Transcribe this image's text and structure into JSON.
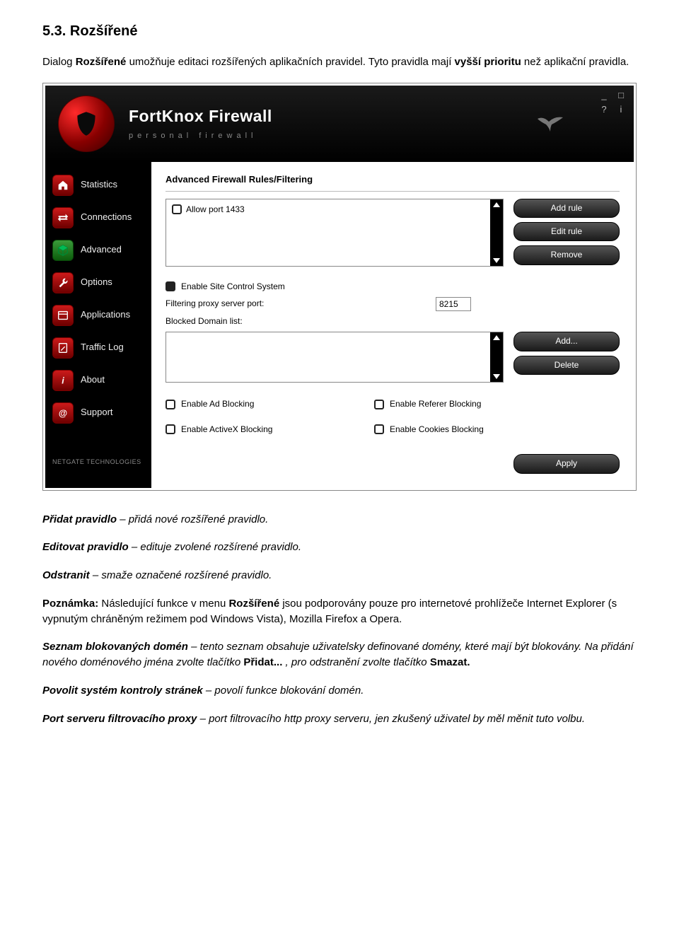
{
  "doc": {
    "heading": "5.3. Rozšířené",
    "intro_1": "Dialog ",
    "intro_strong": "Rozšířené",
    "intro_2": " umožňuje editaci rozšířených aplikačních pravidel. Tyto pravidla mají ",
    "intro_bold2": "vyšší prioritu",
    "intro_3": " než aplikační pravidla.",
    "p_add_label": "Přidat pravidlo",
    "p_add_text": " – přidá nové rozšířené pravidlo.",
    "p_edit_label": "Editovat pravidlo",
    "p_edit_text": " – edituje zvolené rozšírené pravidlo.",
    "p_del_label": "Odstranit",
    "p_del_text": " – smaže označené rozšírené pravidlo.",
    "note_label": "Poznámka:",
    "note_text_1": " Následující funkce v menu ",
    "note_strong": "Rozšířené",
    "note_text_2": " jsou podporovány pouze pro internetové prohlížeče Internet Explorer (s vypnutým chráněným režimem pod Windows Vista), Mozilla Firefox a Opera.",
    "p_blocked_label": "Seznam blokovaných domén",
    "p_blocked_text_1": " – tento seznam obsahuje uživatelsky definované domény, které mají být blokovány. Na přidání nového doménového jména zvolte tlačítko ",
    "p_blocked_btn1": "Přidat...",
    "p_blocked_text_2": ", pro odstranění zvolte tlačítko ",
    "p_blocked_btn2": "Smazat.",
    "p_enable_label": "Povolit systém kontroly stránek",
    "p_enable_text": " – povolí funkce blokování domén.",
    "p_port_label": "Port serveru filtrovacího proxy",
    "p_port_text": " – port filtrovacího http proxy serveru, jen zkušený uživatel by měl měnit tuto volbu."
  },
  "app": {
    "title": "FortKnox Firewall",
    "subtitle": "personal firewall",
    "window_controls": {
      "min": "_",
      "max": "□",
      "help": "?",
      "info": "i"
    },
    "vendor": "NETGATE TECHNOLOGIES",
    "nav": [
      {
        "label": "Statistics"
      },
      {
        "label": "Connections"
      },
      {
        "label": "Advanced"
      },
      {
        "label": "Options"
      },
      {
        "label": "Applications"
      },
      {
        "label": "Traffic Log"
      },
      {
        "label": "About"
      },
      {
        "label": "Support"
      }
    ],
    "panel": {
      "title": "Advanced Firewall Rules/Filtering",
      "rule_item": "Allow port 1433",
      "btn_add_rule": "Add rule",
      "btn_edit_rule": "Edit rule",
      "btn_remove": "Remove",
      "chk_site_control": "Enable Site Control System",
      "proxy_label": "Filtering proxy server port:",
      "proxy_value": "8215",
      "blocked_label": "Blocked Domain list:",
      "btn_add_domain": "Add...",
      "btn_delete_domain": "Delete",
      "chk_ad": "Enable Ad Blocking",
      "chk_referer": "Enable Referer Blocking",
      "chk_activex": "Enable ActiveX Blocking",
      "chk_cookies": "Enable Cookies Blocking",
      "btn_apply": "Apply"
    }
  }
}
